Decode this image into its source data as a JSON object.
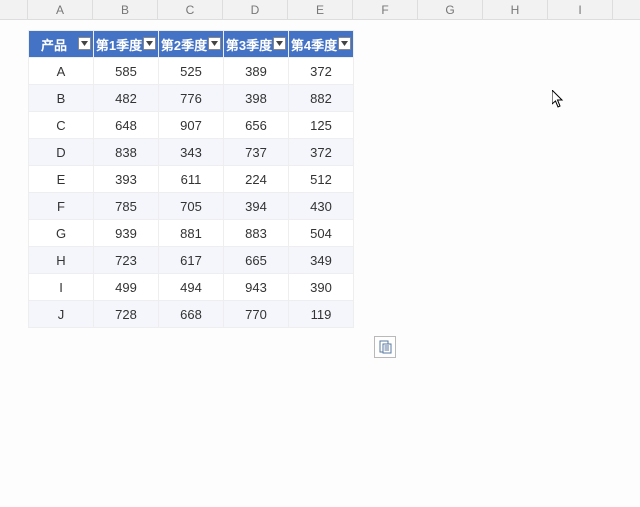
{
  "columns": [
    "A",
    "B",
    "C",
    "D",
    "E",
    "F",
    "G",
    "H",
    "I"
  ],
  "table": {
    "headers": [
      "产品",
      "第1季度",
      "第2季度",
      "第3季度",
      "第4季度"
    ],
    "rows": [
      {
        "product": "A",
        "q1": 585,
        "q2": 525,
        "q3": 389,
        "q4": 372
      },
      {
        "product": "B",
        "q1": 482,
        "q2": 776,
        "q3": 398,
        "q4": 882
      },
      {
        "product": "C",
        "q1": 648,
        "q2": 907,
        "q3": 656,
        "q4": 125
      },
      {
        "product": "D",
        "q1": 838,
        "q2": 343,
        "q3": 737,
        "q4": 372
      },
      {
        "product": "E",
        "q1": 393,
        "q2": 611,
        "q3": 224,
        "q4": 512
      },
      {
        "product": "F",
        "q1": 785,
        "q2": 705,
        "q3": 394,
        "q4": 430
      },
      {
        "product": "G",
        "q1": 939,
        "q2": 881,
        "q3": 883,
        "q4": 504
      },
      {
        "product": "H",
        "q1": 723,
        "q2": 617,
        "q3": 665,
        "q4": 349
      },
      {
        "product": "I",
        "q1": 499,
        "q2": 494,
        "q3": 943,
        "q4": 390
      },
      {
        "product": "J",
        "q1": 728,
        "q2": 668,
        "q3": 770,
        "q4": 119
      }
    ]
  },
  "ui": {
    "paste_options_label": "粘贴选项"
  }
}
